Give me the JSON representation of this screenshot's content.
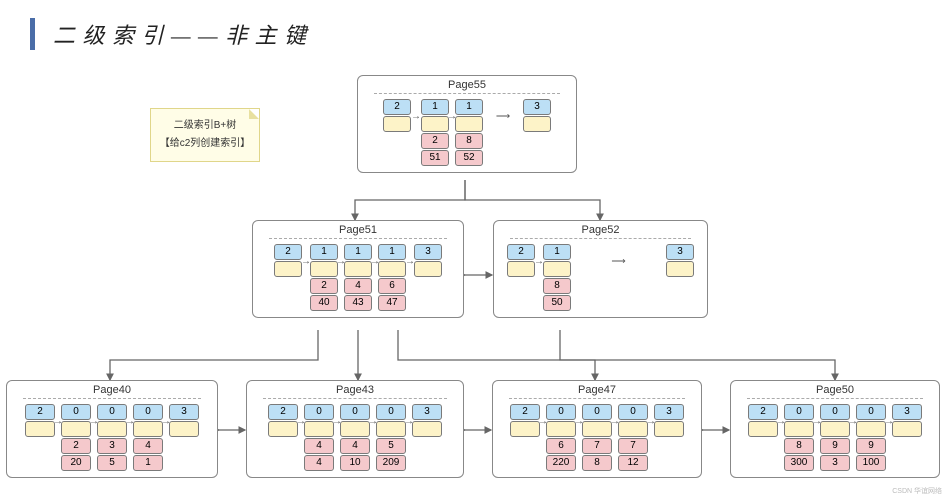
{
  "title": "二 级 索 引 — — 非 主 键",
  "note": {
    "line1": "二级索引B+树",
    "line2": "【给c2列创建索引】"
  },
  "watermark": "CSDN 华谊网络",
  "pages": {
    "p55": {
      "label": "Page55",
      "entries": [
        {
          "top": "2",
          "ptr": "",
          "mid": null,
          "bot": null,
          "gap_after": "short"
        },
        {
          "top": "1",
          "ptr": "",
          "mid": "2",
          "bot": "51",
          "gap_after": "none"
        },
        {
          "top": "1",
          "ptr": "",
          "mid": "8",
          "bot": "52",
          "gap_after": "long"
        },
        {
          "top": "3",
          "ptr": "",
          "mid": null,
          "bot": null,
          "gap_after": "end"
        }
      ]
    },
    "p51": {
      "label": "Page51",
      "entries": [
        {
          "top": "2",
          "ptr": "",
          "mid": null,
          "bot": null,
          "gap_after": "short"
        },
        {
          "top": "1",
          "ptr": "",
          "mid": "2",
          "bot": "40",
          "gap_after": "none"
        },
        {
          "top": "1",
          "ptr": "",
          "mid": "4",
          "bot": "43",
          "gap_after": "none"
        },
        {
          "top": "1",
          "ptr": "",
          "mid": "6",
          "bot": "47",
          "gap_after": "short"
        },
        {
          "top": "3",
          "ptr": "",
          "mid": null,
          "bot": null,
          "gap_after": "end"
        }
      ]
    },
    "p52": {
      "label": "Page52",
      "entries": [
        {
          "top": "2",
          "ptr": "",
          "mid": null,
          "bot": null,
          "gap_after": "short"
        },
        {
          "top": "1",
          "ptr": "",
          "mid": "8",
          "bot": "50",
          "gap_after": "long2"
        },
        {
          "top": "3",
          "ptr": "",
          "mid": null,
          "bot": null,
          "gap_after": "end"
        }
      ]
    },
    "p40": {
      "label": "Page40",
      "entries": [
        {
          "top": "2",
          "ptr": "",
          "mid": null,
          "bot": null,
          "gap_after": "short"
        },
        {
          "top": "0",
          "ptr": "",
          "mid": "2",
          "bot": "20",
          "gap_after": "none"
        },
        {
          "top": "0",
          "ptr": "",
          "mid": "3",
          "bot": "5",
          "gap_after": "none"
        },
        {
          "top": "0",
          "ptr": "",
          "mid": "4",
          "bot": "1",
          "gap_after": "short"
        },
        {
          "top": "3",
          "ptr": "",
          "mid": null,
          "bot": null,
          "gap_after": "end"
        }
      ]
    },
    "p43": {
      "label": "Page43",
      "entries": [
        {
          "top": "2",
          "ptr": "",
          "mid": null,
          "bot": null,
          "gap_after": "short"
        },
        {
          "top": "0",
          "ptr": "",
          "mid": "4",
          "bot": "4",
          "gap_after": "none"
        },
        {
          "top": "0",
          "ptr": "",
          "mid": "4",
          "bot": "10",
          "gap_after": "none"
        },
        {
          "top": "0",
          "ptr": "",
          "mid": "5",
          "bot": "209",
          "gap_after": "short"
        },
        {
          "top": "3",
          "ptr": "",
          "mid": null,
          "bot": null,
          "gap_after": "end"
        }
      ]
    },
    "p47": {
      "label": "Page47",
      "entries": [
        {
          "top": "2",
          "ptr": "",
          "mid": null,
          "bot": null,
          "gap_after": "short"
        },
        {
          "top": "0",
          "ptr": "",
          "mid": "6",
          "bot": "220",
          "gap_after": "none"
        },
        {
          "top": "0",
          "ptr": "",
          "mid": "7",
          "bot": "8",
          "gap_after": "none"
        },
        {
          "top": "0",
          "ptr": "",
          "mid": "7",
          "bot": "12",
          "gap_after": "short"
        },
        {
          "top": "3",
          "ptr": "",
          "mid": null,
          "bot": null,
          "gap_after": "end"
        }
      ]
    },
    "p50": {
      "label": "Page50",
      "entries": [
        {
          "top": "2",
          "ptr": "",
          "mid": null,
          "bot": null,
          "gap_after": "short"
        },
        {
          "top": "0",
          "ptr": "",
          "mid": "8",
          "bot": "300",
          "gap_after": "none"
        },
        {
          "top": "0",
          "ptr": "",
          "mid": "9",
          "bot": "3",
          "gap_after": "none"
        },
        {
          "top": "0",
          "ptr": "",
          "mid": "9",
          "bot": "100",
          "gap_after": "short"
        },
        {
          "top": "3",
          "ptr": "",
          "mid": null,
          "bot": null,
          "gap_after": "end"
        }
      ]
    }
  },
  "chart_data": {
    "type": "tree",
    "description": "Secondary index B+ tree on column c2",
    "root": "Page55",
    "nodes": {
      "Page55": {
        "type": "internal",
        "children": [
          {
            "key_c2": 2,
            "page": "Page51"
          },
          {
            "key_c2": 8,
            "page": "Page52"
          }
        ]
      },
      "Page51": {
        "type": "internal",
        "children": [
          {
            "key_c2": 2,
            "page": "Page40"
          },
          {
            "key_c2": 4,
            "page": "Page43"
          },
          {
            "key_c2": 6,
            "page": "Page47"
          }
        ]
      },
      "Page52": {
        "type": "internal",
        "children": [
          {
            "key_c2": 8,
            "page": "Page50"
          }
        ]
      },
      "Page40": {
        "type": "leaf",
        "records": [
          {
            "c2": 2,
            "pk": 20
          },
          {
            "c2": 3,
            "pk": 5
          },
          {
            "c2": 4,
            "pk": 1
          }
        ]
      },
      "Page43": {
        "type": "leaf",
        "records": [
          {
            "c2": 4,
            "pk": 4
          },
          {
            "c2": 4,
            "pk": 10
          },
          {
            "c2": 5,
            "pk": 209
          }
        ]
      },
      "Page47": {
        "type": "leaf",
        "records": [
          {
            "c2": 6,
            "pk": 220
          },
          {
            "c2": 7,
            "pk": 8
          },
          {
            "c2": 7,
            "pk": 12
          }
        ]
      },
      "Page50": {
        "type": "leaf",
        "records": [
          {
            "c2": 8,
            "pk": 300
          },
          {
            "c2": 9,
            "pk": 3
          },
          {
            "c2": 9,
            "pk": 100
          }
        ]
      }
    },
    "leaf_order": [
      "Page40",
      "Page43",
      "Page47",
      "Page50"
    ],
    "record_header_values": {
      "infimum": 2,
      "data": 0,
      "internal_data": 1,
      "supremum": 3
    }
  }
}
